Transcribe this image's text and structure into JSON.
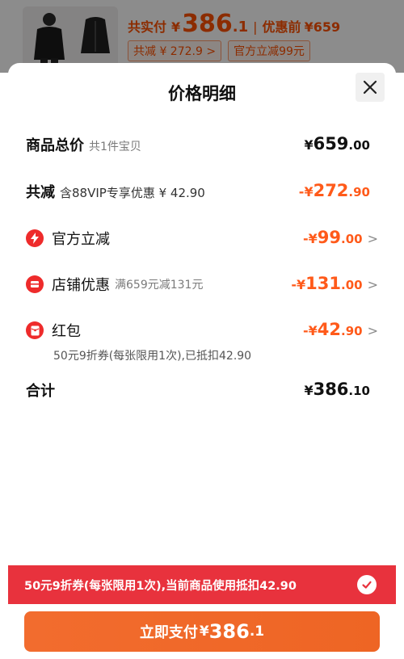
{
  "background": {
    "paid_label": "共实付",
    "paid_symbol": "¥",
    "paid_int": "386",
    "paid_dec": ".1",
    "separator": "|",
    "before_label": "优惠前",
    "before_value": "¥659",
    "chip_discount": "共减 ¥ 272.9 >",
    "chip_official": "官方立减99元"
  },
  "sheet": {
    "title": "价格明细"
  },
  "total_goods": {
    "label": "商品总价",
    "sub": "共1件宝贝",
    "symbol": "¥",
    "int": "659",
    "dec": ".00"
  },
  "total_reduction": {
    "label": "共减",
    "sub": "含88VIP专享优惠 ¥ 42.90",
    "symbol": "-¥",
    "int": "272",
    "dec": ".90"
  },
  "items": [
    {
      "name": "官方立减",
      "sub": "",
      "symbol": "-¥",
      "int": "99",
      "dec": ".00",
      "chevron": ">",
      "icon": "lightning-icon"
    },
    {
      "name": "店铺优惠",
      "sub": "满659元减131元",
      "symbol": "-¥",
      "int": "131",
      "dec": ".00",
      "chevron": ">",
      "icon": "store-icon"
    },
    {
      "name": "红包",
      "sub": "",
      "symbol": "-¥",
      "int": "42",
      "dec": ".90",
      "chevron": ">",
      "icon": "red-packet-icon",
      "note": "50元9折券(每张限用1次),已抵扣42.90"
    }
  ],
  "sum": {
    "label": "合计",
    "symbol": "¥",
    "int": "386",
    "dec": ".10"
  },
  "banner": {
    "text": "50元9折券(每张限用1次),当前商品使用抵扣42.90"
  },
  "pay_button": {
    "label": "立即支付",
    "symbol": "¥",
    "int": "386",
    "dec": ".1"
  },
  "colors": {
    "accent_orange": "#ff5a1a",
    "banner_red": "#e8323d",
    "icon_red": "#ee2b2b",
    "pay_orange": "#f26c2e"
  }
}
